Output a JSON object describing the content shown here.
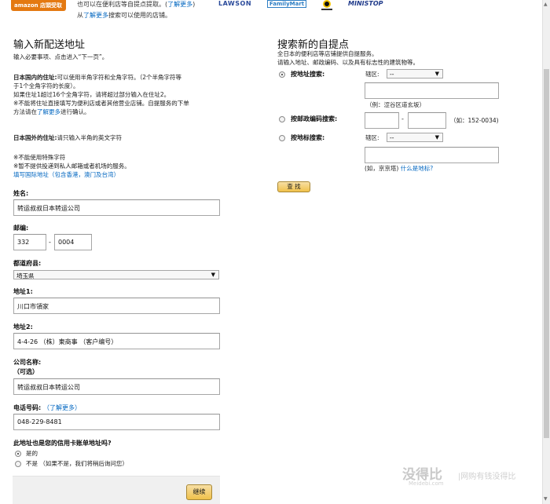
{
  "top": {
    "amazon_logo": "amazon 店頭受取",
    "line1_prefix": "也可以在便利店等自提点提取。(",
    "line1_link": "了解更多",
    "line1_suffix": ")",
    "line2_prefix": "从",
    "line2_link": "了解更多",
    "line2_suffix": "搜索可以使用的店铺。",
    "logos": [
      "LAWSON",
      "FamilyMart",
      "MINISTOP"
    ],
    "yamato_icon": "yamato-logo-icon"
  },
  "left": {
    "title": "输入新配送地址",
    "subtitle": "输入必要事项、点击进入“下一页”。",
    "domestic_label": "日本国内的住址:",
    "domestic_text1": "可以使用半角字符和全角字符。（2个半角字符等",
    "domestic_text2": "于1个全角字符的长度）。",
    "domestic_text3": "如果住址1超过16个全角字符，请将超过部分输入在住址2。",
    "domestic_text4": "※不能将住址直接填写为便利店或者其他营业店铺。自提服务的下单",
    "domestic_text5_prefix": "方法请在",
    "domestic_text5_link": "了解更多",
    "domestic_text5_suffix": "进行确认。",
    "foreign_label": "日本国外的住址:",
    "foreign_text": "请只输入半角的英文字符",
    "note1": "※不能使用特殊字符",
    "note2": "※暂不提供投递到私人邮箱或者机场的服务。",
    "intl_link": "填写国际地址（包含香港，澳门及台湾）",
    "name_label": "姓名:",
    "name_value": "转运叔叔日本转运公司",
    "zip_label": "邮编:",
    "zip1": "332",
    "zip_dash": "-",
    "zip2": "0004",
    "pref_label": "都道府县:",
    "pref_value": "埼玉県",
    "addr1_label": "地址1:",
    "addr1_value": "川口市領家",
    "addr2_label": "地址2:",
    "addr2_value": "4-4-26 （株）東商事 （客户编号）",
    "company_label": "公司名称:",
    "company_optional": "（可选）",
    "company_value": "转运叔叔日本转运公司",
    "phone_label": "电话号码:",
    "phone_link": "（了解更多）",
    "phone_value": "048-229-8481",
    "billing_question": "此地址也是您的信用卡账单地址吗?",
    "billing_yes": "是的",
    "billing_no": "不是  （如果不是，我们将稍后询问您）",
    "continue_button": "继续"
  },
  "right": {
    "title": "搜索新的自提点",
    "desc1": "全日本的便利店等店铺提供自提服务。",
    "desc2": "请输入地址、邮政编码、以及具有标志性的建筑物等。",
    "by_address": "按地址搜索:",
    "area_label": "辖区:",
    "area_value": "--",
    "address_example": "（例：涩谷区道玄坂）",
    "by_zip": "按邮政编码搜索:",
    "zip_dash": "-",
    "zip_example": "（如：152-0034)",
    "by_landmark": "按地标搜索:",
    "area_label2": "辖区:",
    "area_value2": "--",
    "landmark_example_prefix": "(如，京京塔)",
    "landmark_link": "什么是地标?",
    "search_button": "查 找"
  },
  "watermark": {
    "site": "没得比",
    "domain": "Meidebi.com",
    "slogan": "|网购有钱没得比"
  }
}
